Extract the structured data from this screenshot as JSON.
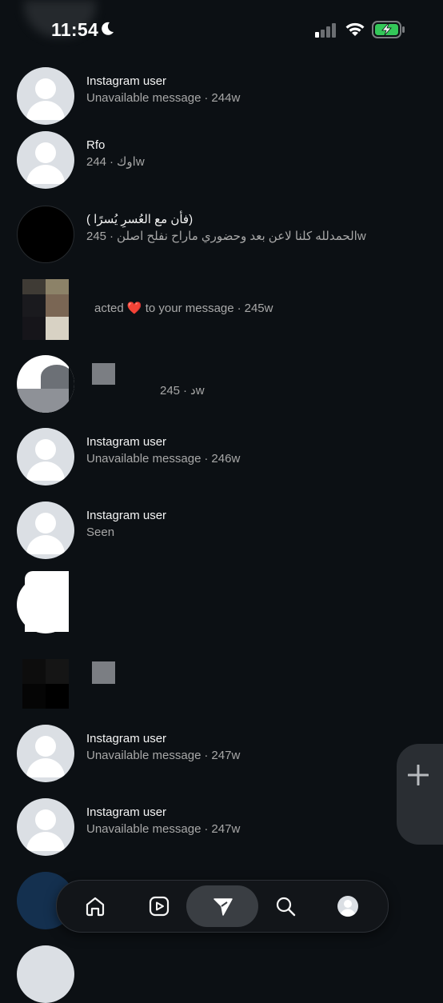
{
  "status_bar": {
    "time": "11:54"
  },
  "threads": [
    {
      "name": "Instagram user",
      "preview": "Unavailable message",
      "age": "244w"
    },
    {
      "name": "Rfo",
      "preview": "اوك",
      "age": "244w"
    },
    {
      "name": "(فأن مع العُسرِ يُسرًا )",
      "preview": "الحمدلله كلنا لاعن بعد وحضوري ماراح نفلح اصلن",
      "age": "245w"
    },
    {
      "name": "",
      "preview": "acted ❤️ to your message",
      "age": "245w"
    },
    {
      "name": "",
      "preview": "د",
      "age": "245w"
    },
    {
      "name": "Instagram user",
      "preview": "Unavailable message",
      "age": "246w"
    },
    {
      "name": "Instagram user",
      "preview": "Seen",
      "age": ""
    },
    {
      "name": "",
      "preview": "",
      "age": ""
    },
    {
      "name": "",
      "preview": "",
      "age": ""
    },
    {
      "name": "Instagram user",
      "preview": "Unavailable message",
      "age": "247w"
    },
    {
      "name": "Instagram user",
      "preview": "Unavailable message",
      "age": "247w"
    }
  ],
  "separator": "·",
  "icons": {
    "status": [
      "moon-icon",
      "signal-icon",
      "wifi-icon",
      "battery-charging-icon"
    ],
    "fab": "plus-icon",
    "nav": [
      "home-icon",
      "reels-icon",
      "direct-messages-icon",
      "search-icon",
      "profile-icon"
    ]
  },
  "colors": {
    "background": "#0c1014",
    "secondary_text": "#a8a8a8",
    "battery": "#34c759",
    "active_nav": "#3a3e43"
  }
}
